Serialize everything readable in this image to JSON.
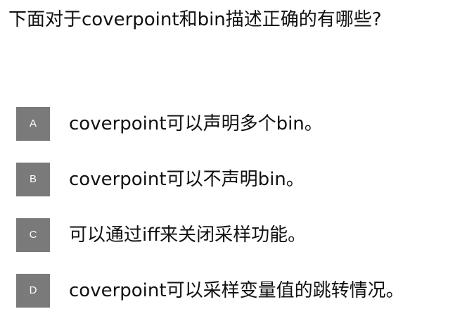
{
  "question": {
    "text": "下面对于coverpoint和bin描述正确的有哪些?"
  },
  "options": [
    {
      "letter": "A",
      "text": "coverpoint可以声明多个bin。"
    },
    {
      "letter": "B",
      "text": "coverpoint可以不声明bin。"
    },
    {
      "letter": "C",
      "text": "可以通过iff来关闭采样功能。"
    },
    {
      "letter": "D",
      "text": "coverpoint可以采样变量值的跳转情况。"
    }
  ],
  "colors": {
    "letter_box_bg": "#7a7a7a",
    "letter_text": "#ffffff",
    "text": "#111111",
    "background": "#ffffff"
  }
}
